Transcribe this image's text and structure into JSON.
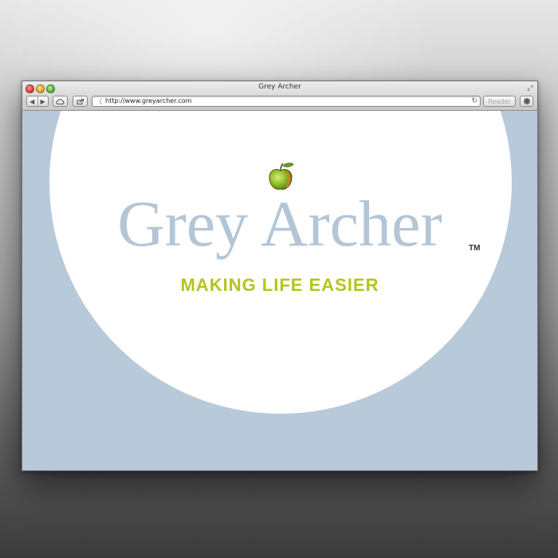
{
  "window": {
    "title": "Grey Archer"
  },
  "toolbar": {
    "back_icon": "back-arrow-icon",
    "forward_icon": "forward-arrow-icon",
    "cloud_icon": "cloud-icon",
    "share_icon": "share-icon",
    "url": "http://www.greyarcher.com",
    "reader_label": "Reader",
    "gear_icon": "gear-icon"
  },
  "page": {
    "brand_name": "Grey Archer",
    "trademark": "TM",
    "tagline": "MAKING LIFE EASIER",
    "logo_icon": "apple-icon"
  },
  "colors": {
    "background": "#b8c9d9",
    "brand_text": "#b4c6d6",
    "tagline": "#b4c41b",
    "apple_green": "#8fbf2a"
  }
}
